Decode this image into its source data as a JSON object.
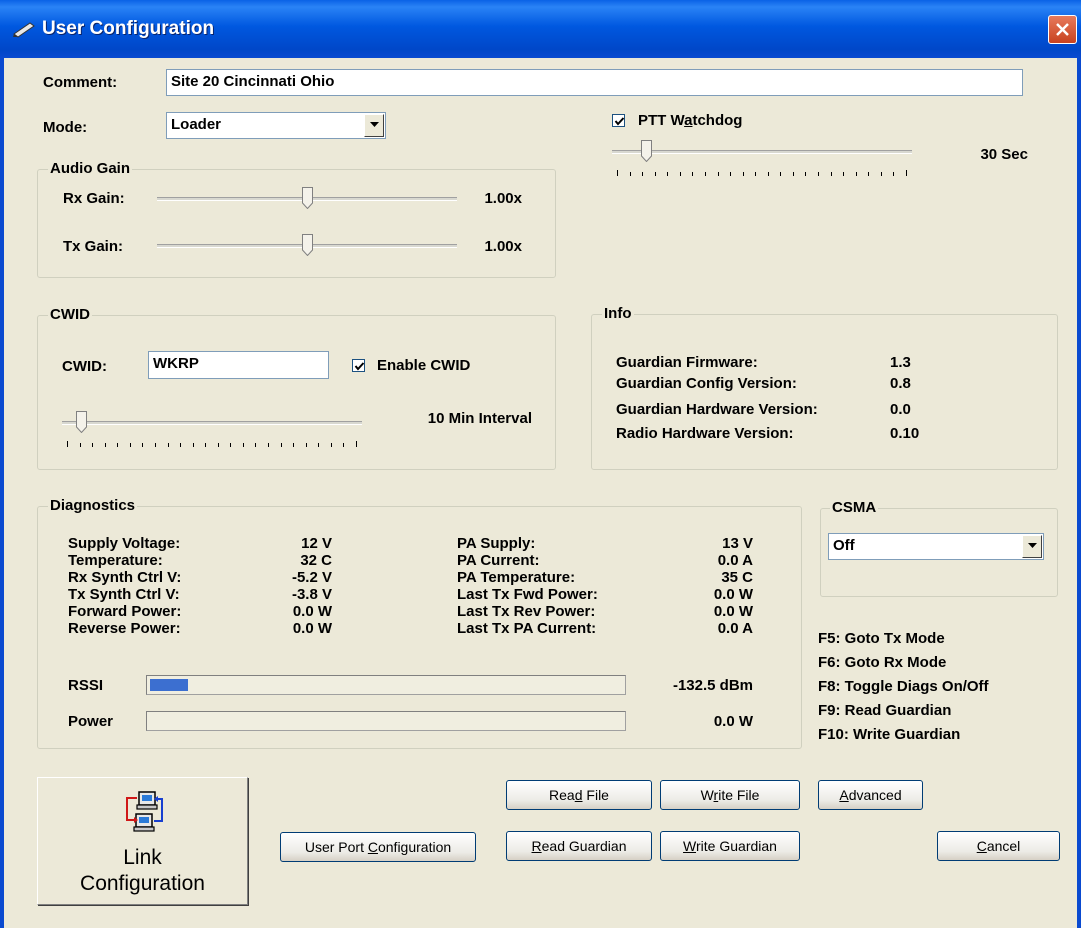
{
  "window": {
    "title": "User Configuration"
  },
  "comment": {
    "label": "Comment:",
    "value": "Site 20 Cincinnati Ohio"
  },
  "mode": {
    "label": "Mode:",
    "value": "Loader"
  },
  "ptt": {
    "label": "PTT Watchdog",
    "accel": "a",
    "checked": true,
    "value_text": "30 Sec",
    "level": 0.1
  },
  "audio_gain": {
    "title": "Audio Gain",
    "rx": {
      "label": "Rx Gain:",
      "value_text": "1.00x",
      "level": 0.5
    },
    "tx": {
      "label": "Tx Gain:",
      "value_text": "1.00x",
      "level": 0.5
    }
  },
  "cwid": {
    "title": "CWID",
    "label": "CWID:",
    "value": "WKRP",
    "enable_label": "Enable CWID",
    "enabled": true,
    "interval_text": "10 Min Interval",
    "level": 0.05
  },
  "info": {
    "title": "Info",
    "rows": [
      {
        "label": "Guardian Firmware:",
        "value": "1.3"
      },
      {
        "label": "Guardian Config Version:",
        "value": "0.8"
      },
      {
        "label": "Guardian Hardware Version:",
        "value": "0.0"
      },
      {
        "label": "Radio Hardware Version:",
        "value": "0.10"
      }
    ]
  },
  "diagnostics": {
    "title": "Diagnostics",
    "left": [
      {
        "label": "Supply Voltage:",
        "value": "12 V"
      },
      {
        "label": "Temperature:",
        "value": "32 C"
      },
      {
        "label": "Rx Synth Ctrl V:",
        "value": "-5.2 V"
      },
      {
        "label": "Tx Synth Ctrl V:",
        "value": "-3.8 V"
      },
      {
        "label": "Forward Power:",
        "value": "0.0 W"
      },
      {
        "label": "Reverse Power:",
        "value": "0.0 W"
      }
    ],
    "right": [
      {
        "label": "PA Supply:",
        "value": "13 V"
      },
      {
        "label": "PA Current:",
        "value": "0.0 A"
      },
      {
        "label": "PA Temperature:",
        "value": "35 C"
      },
      {
        "label": "Last Tx Fwd Power:",
        "value": "0.0 W"
      },
      {
        "label": "Last Tx Rev Power:",
        "value": "0.0 W"
      },
      {
        "label": "Last Tx PA Current:",
        "value": "0.0 A"
      }
    ],
    "rssi": {
      "label": "RSSI",
      "value": "-132.5 dBm",
      "level": 0.08
    },
    "power": {
      "label": "Power",
      "value": "0.0 W",
      "level": 0.0
    }
  },
  "csma": {
    "title": "CSMA",
    "value": "Off"
  },
  "hotkeys": [
    "F5: Goto Tx Mode",
    "F6: Goto Rx Mode",
    "F8: Toggle Diags On/Off",
    "F9: Read Guardian",
    "F10: Write Guardian"
  ],
  "buttons": {
    "link_line1": "Link",
    "link_line2": "Configuration",
    "user_port": {
      "label": "User Port Configuration",
      "accel": "C"
    },
    "read_file": {
      "label": "Read File",
      "accel": "d"
    },
    "write_file": {
      "label": "Write File",
      "accel": "r"
    },
    "advanced": {
      "label": "Advanced",
      "accel": "A"
    },
    "read_guardian": {
      "label": "Read Guardian",
      "accel": "R"
    },
    "write_guardian": {
      "label": "Write Guardian",
      "accel": "W"
    },
    "cancel": {
      "label": "Cancel",
      "accel": "C"
    }
  },
  "colors": {
    "titlebar": "#0058e0",
    "face": "#ece9d8",
    "rssi_fill": "#3c6fd0",
    "close": "#d0502f"
  },
  "icons": {
    "title": "pencil-icon",
    "link": "network-computers-icon",
    "close": "close-icon"
  }
}
